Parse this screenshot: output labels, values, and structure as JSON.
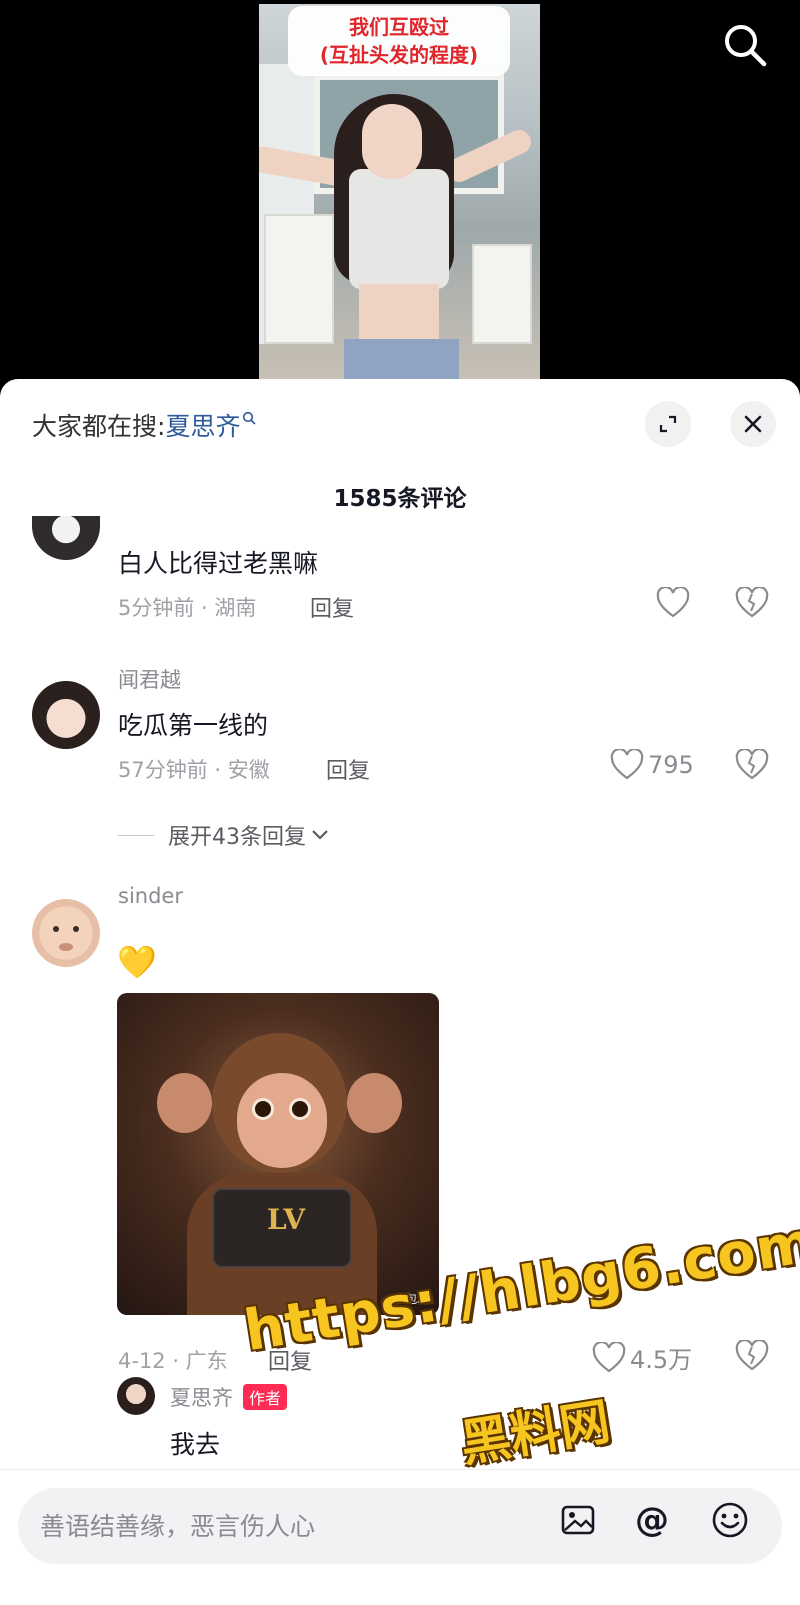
{
  "video": {
    "caption_line1": "我们互殴过",
    "caption_line2": "(互扯头发的程度)"
  },
  "sheet": {
    "hot_search_prefix": "大家都在搜:",
    "hot_search_term": "夏思齐",
    "comment_count": "1585条评论"
  },
  "comments": [
    {
      "username": "",
      "text": "白人比得过老黑嘛",
      "meta": "5分钟前 · 湖南",
      "reply": "回复",
      "likes": ""
    },
    {
      "username": "闻君越",
      "text": "吃瓜第一线的",
      "meta": "57分钟前 · 安徽",
      "reply": "回复",
      "likes": "795",
      "expand_label": "展开43条回复"
    },
    {
      "username": "sinder",
      "text": "💛",
      "image_label": "LV",
      "image_watermark": "豆包AI",
      "meta": "4-12 · 广东",
      "reply": "回复",
      "likes": "4.5万",
      "sub_reply": {
        "username": "夏思齐",
        "badge": "作者",
        "text": "我去"
      }
    }
  ],
  "watermark": {
    "url": "https://hlbg6.com",
    "name": "黑料网"
  },
  "input": {
    "placeholder": "善语结善缘，恶言伤人心"
  }
}
